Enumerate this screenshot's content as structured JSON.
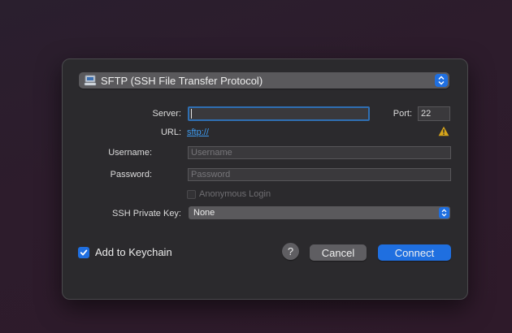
{
  "protocol": {
    "selected": "SFTP (SSH File Transfer Protocol)",
    "icon": "network-drive-icon"
  },
  "form": {
    "server_label": "Server:",
    "server_value": "",
    "port_label": "Port:",
    "port_value": "22",
    "url_label": "URL:",
    "url_value": "sftp://",
    "username_label": "Username:",
    "username_placeholder": "Username",
    "password_label": "Password:",
    "password_placeholder": "Password",
    "anonymous_label": "Anonymous Login",
    "ssh_key_label": "SSH Private Key:",
    "ssh_key_value": "None"
  },
  "footer": {
    "keychain_label": "Add to Keychain",
    "keychain_checked": true,
    "help_label": "?",
    "cancel_label": "Cancel",
    "connect_label": "Connect"
  },
  "colors": {
    "accent": "#1f6fe0",
    "link": "#3e9cf2",
    "warning": "#d6a51a",
    "dialog_bg": "#2b2a2d"
  }
}
